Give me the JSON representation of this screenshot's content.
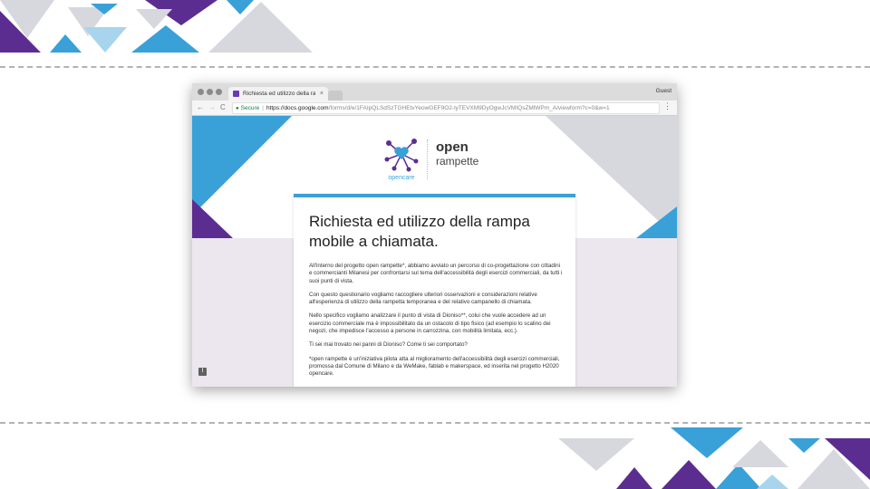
{
  "browser": {
    "tab_title": "Richiesta ed utilizzo della ramp",
    "tab_close": "×",
    "profile": "Guest",
    "nav_back": "←",
    "nav_forward": "→",
    "nav_reload": "C",
    "secure_label": "Secure",
    "separator": "|",
    "url_host": "https://docs.google.com",
    "url_path": "/forms/d/e/1FAIpQLSdSzTGHEtvYeowGEF9O2-lyTEVXM9DyOgwJcVMIQsZMlWPm_A/viewform?c=0&w=1",
    "menu_label": "⋮"
  },
  "logo": {
    "word1": "open",
    "word2": "rampette",
    "sub": "opencare"
  },
  "form": {
    "title": "Richiesta ed utilizzo della rampa mobile a chiamata.",
    "paragraphs": [
      "All'interno del progetto open rampette*, abbiamo avviato un percorso di co-progettazione con cittadini e commercianti Milanesi per confrontarsi sul tema dell'accessibilità degli esercizi commerciali, da tutti i suoi punti di vista.",
      "Con questo questionario vogliamo raccogliere ulteriori osservazioni e considerazioni relative all'esperienza di utilizzo della rampetta temporanea e del relativo campanello di chiamata.",
      "Nello specifico vogliamo analizzare il punto di vista di Dioniso**, colui che vuole accedere ad un esercizio commerciale ma è impossibilitato da un ostacolo di tipo fisico (ad esempio lo scalino dei negozi, che impedisce l'accesso a persone in carrozzina, con mobilità limitata, ecc.).",
      "Ti sei mai trovato nei panni di Dioniso? Come ti sei comportato?",
      "*open rampette è un'iniziativa pilota atta al miglioramento dell'accessibilità degli esercizi commerciali, promossa dal Comune di Milano e da WeMake, fablab e makerspace, ed inserita nel progetto H2020 opencare."
    ]
  },
  "feedback": {
    "label": "!"
  },
  "colors": {
    "purple": "#5c2d91",
    "blue": "#3aa0d8",
    "light_blue": "#a8d4ee",
    "grey": "#d7d8de",
    "lavender": "#ece6ef",
    "secure_green": "#0b8043"
  }
}
